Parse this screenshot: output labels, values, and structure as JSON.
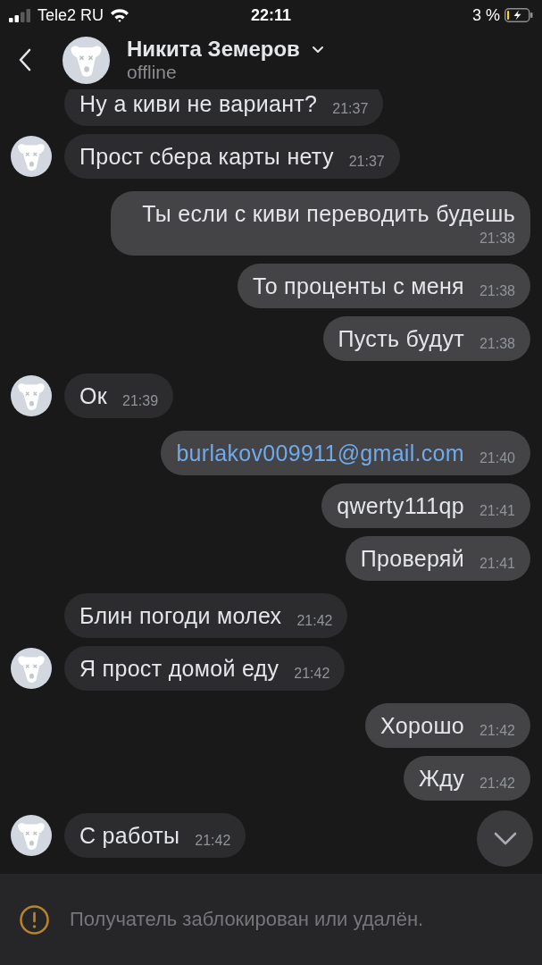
{
  "status_bar": {
    "carrier": "Tele2 RU",
    "time": "22:11",
    "battery": "3 %"
  },
  "header": {
    "name": "Никита Земеров",
    "status": "offline"
  },
  "messages": [
    {
      "outgoing": false,
      "kind": "text",
      "text": "Ну а киви не вариант?",
      "time": "21:37",
      "avatar": false
    },
    {
      "outgoing": false,
      "kind": "text",
      "text": "Прост сбера карты нету",
      "time": "21:37",
      "avatar": true
    },
    {
      "outgoing": true,
      "kind": "text",
      "text": "Ты если с киви переводить будешь",
      "time": "21:38"
    },
    {
      "outgoing": true,
      "kind": "text",
      "text": "То проценты с меня",
      "time": "21:38"
    },
    {
      "outgoing": true,
      "kind": "text",
      "text": "Пусть будут",
      "time": "21:38"
    },
    {
      "outgoing": false,
      "kind": "text",
      "text": "Ок",
      "time": "21:39",
      "avatar": true
    },
    {
      "outgoing": true,
      "kind": "link",
      "text": "burlakov009911@gmail.com",
      "time": "21:40"
    },
    {
      "outgoing": true,
      "kind": "text",
      "text": "qwerty111qp",
      "time": "21:41"
    },
    {
      "outgoing": true,
      "kind": "text",
      "text": "Проверяй",
      "time": "21:41"
    },
    {
      "outgoing": false,
      "kind": "text",
      "text": "Блин погоди молех",
      "time": "21:42",
      "avatar": false
    },
    {
      "outgoing": false,
      "kind": "text",
      "text": "Я прост домой еду",
      "time": "21:42",
      "avatar": true
    },
    {
      "outgoing": true,
      "kind": "text",
      "text": "Хорошо",
      "time": "21:42"
    },
    {
      "outgoing": true,
      "kind": "text",
      "text": "Жду",
      "time": "21:42"
    },
    {
      "outgoing": false,
      "kind": "text",
      "text": "С работы",
      "time": "21:42",
      "avatar": true
    }
  ],
  "notice": {
    "text": "Получатель заблокирован или удалён."
  }
}
